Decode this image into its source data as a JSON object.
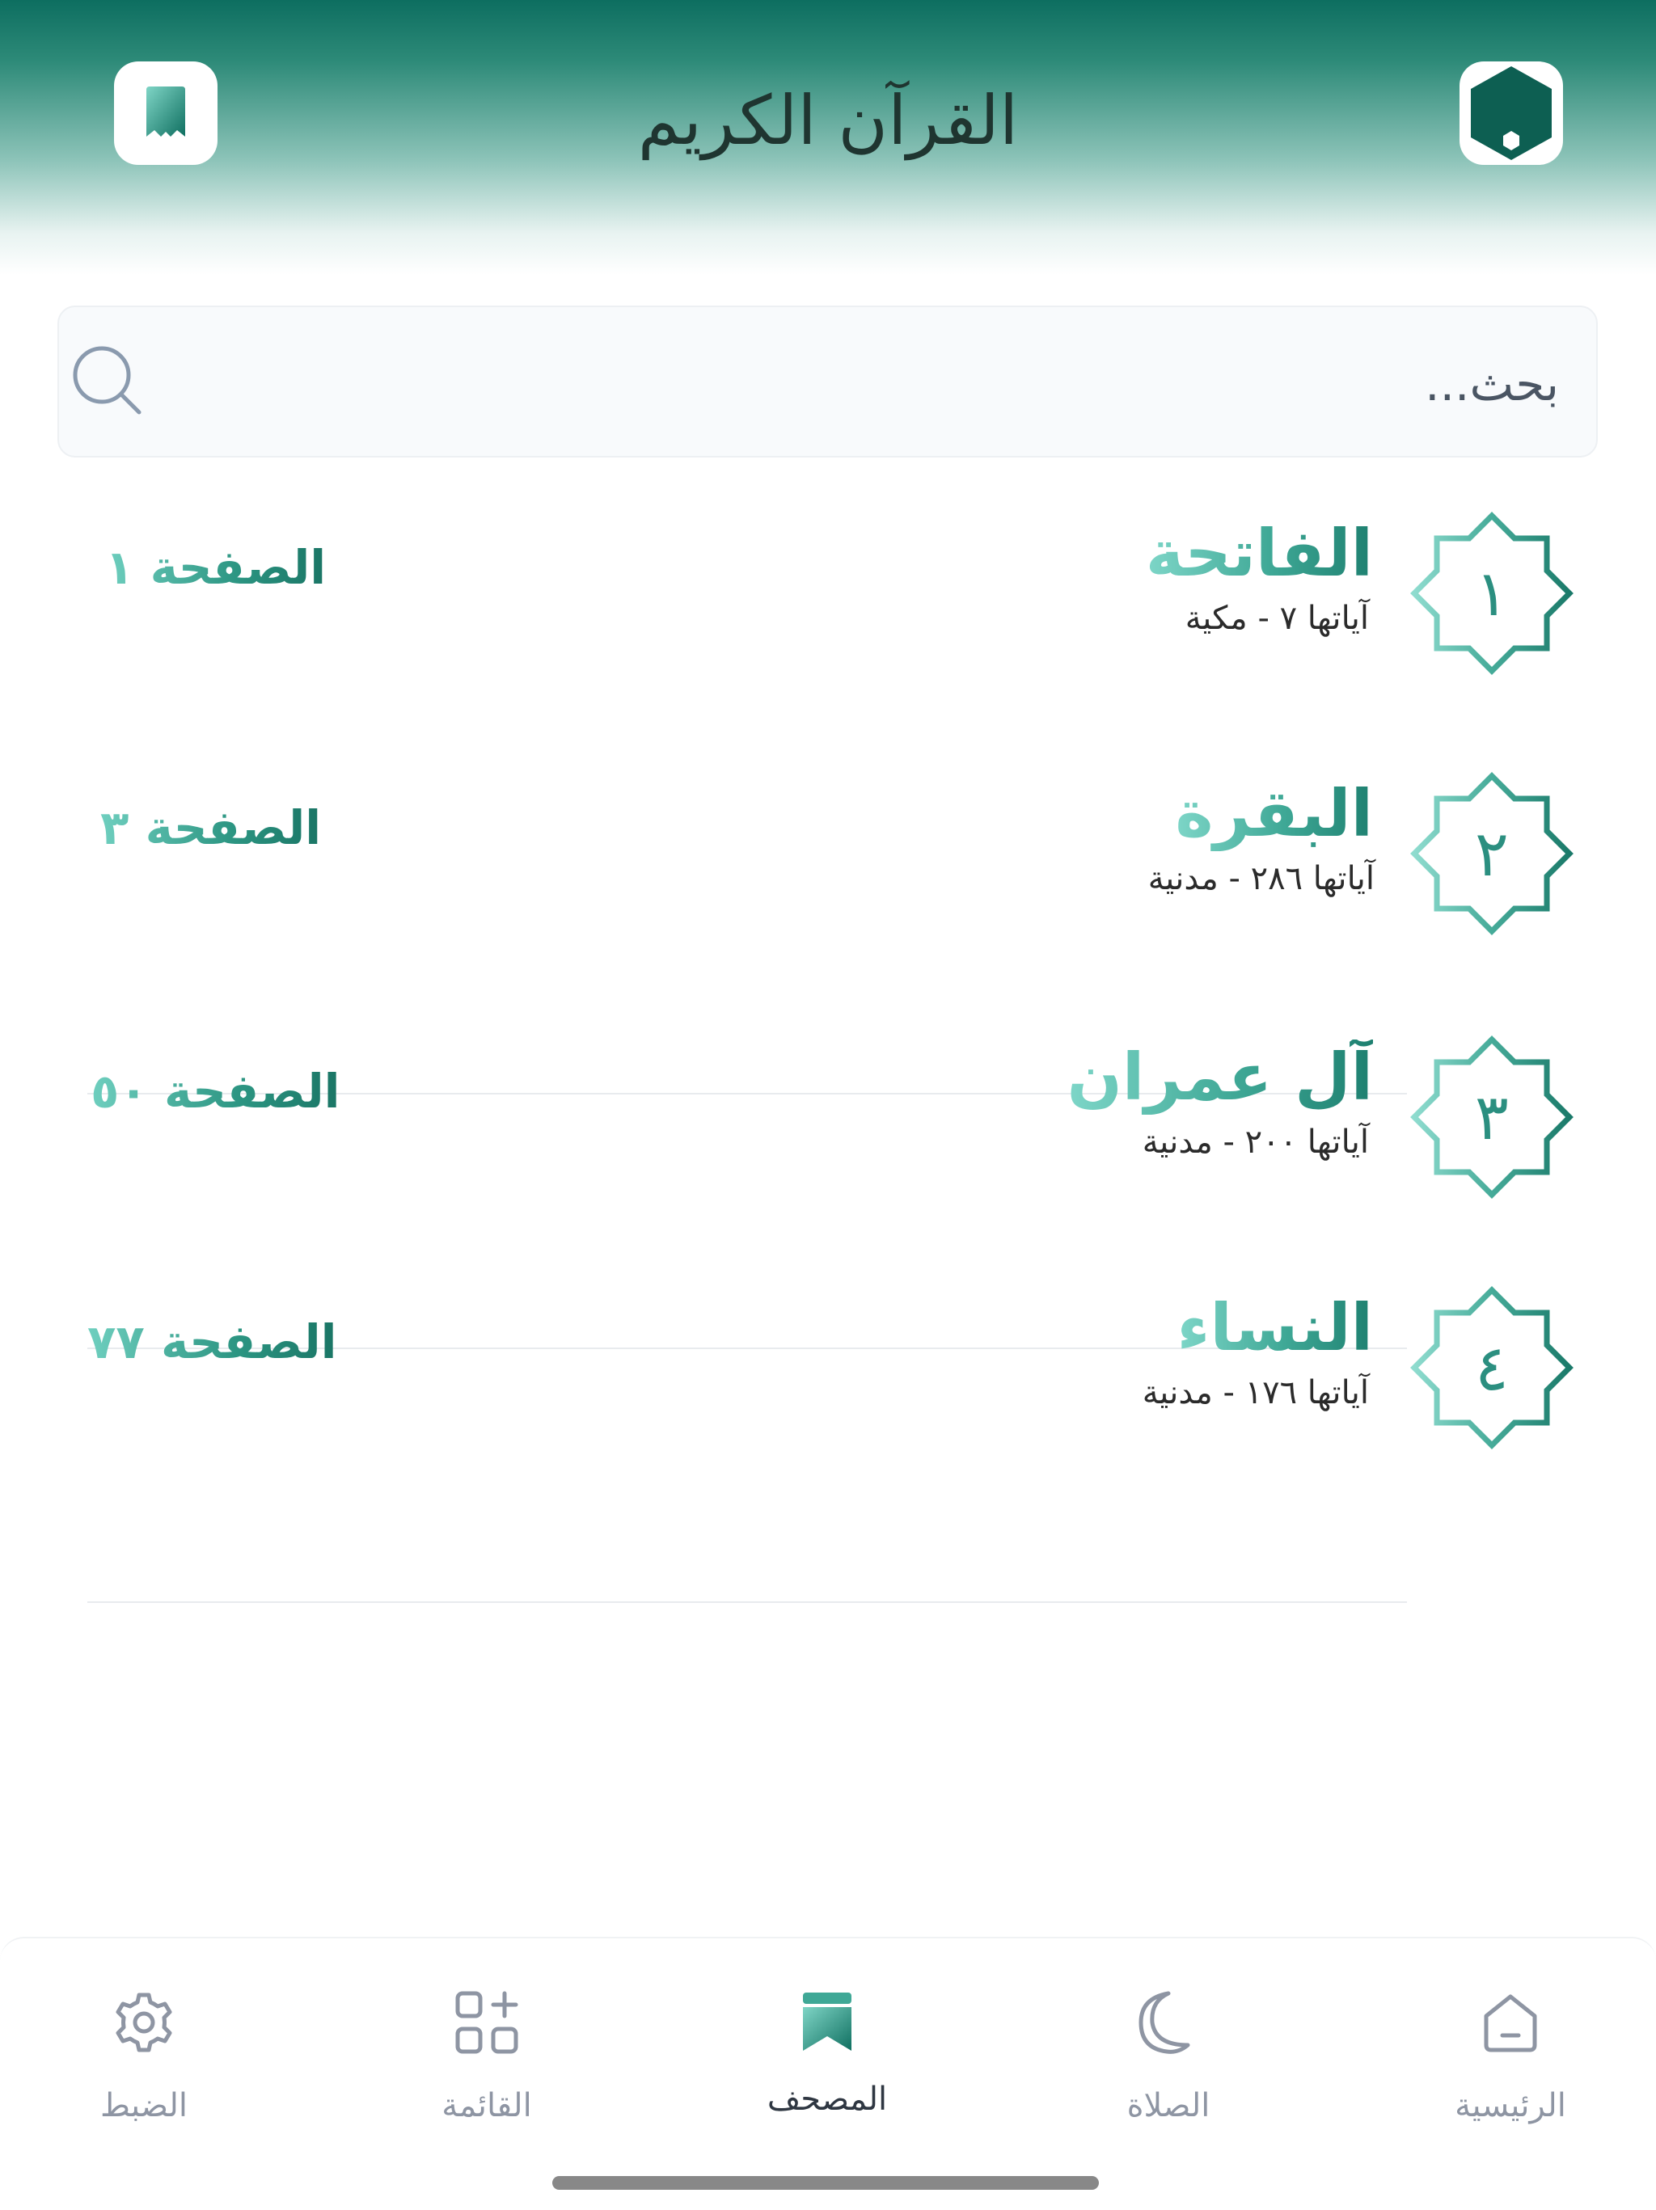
{
  "header": {
    "title": "القرآن الكريم",
    "left_icon": "mushaf-bookmark-icon",
    "right_icon": "hexagon-logo-icon",
    "brand_color": "#0d6e60"
  },
  "search": {
    "placeholder": "بحث...",
    "icon": "search-icon"
  },
  "surahs": [
    {
      "number": "١",
      "name": "الفاتحة",
      "info": "آياتها ٧ - مكية",
      "page": "الصفحة ١"
    },
    {
      "number": "٢",
      "name": "البقرة",
      "info": "آياتها ٢٨٦ - مدنية",
      "page": "الصفحة ٣"
    },
    {
      "number": "٣",
      "name": "آل عمران",
      "info": "آياتها ٢٠٠ - مدنية",
      "page": "الصفحة ٥٠"
    },
    {
      "number": "٤",
      "name": "النساء",
      "info": "آياتها ١٧٦ - مدنية",
      "page": "الصفحة ٧٧"
    }
  ],
  "bottom_nav": {
    "items": [
      {
        "label": "الضبط",
        "icon": "gear-icon",
        "active": false
      },
      {
        "label": "القائمة",
        "icon": "grid-add-icon",
        "active": false
      },
      {
        "label": "المصحف",
        "icon": "mushaf-bookmark-icon",
        "active": true
      },
      {
        "label": "الصلاة",
        "icon": "crescent-moon-icon",
        "active": false
      },
      {
        "label": "الرئيسية",
        "icon": "home-icon",
        "active": false
      }
    ]
  },
  "colors": {
    "accent_light": "#7ed6c8",
    "accent_dark": "#1e8070",
    "nav_inactive": "#8e95a3"
  }
}
